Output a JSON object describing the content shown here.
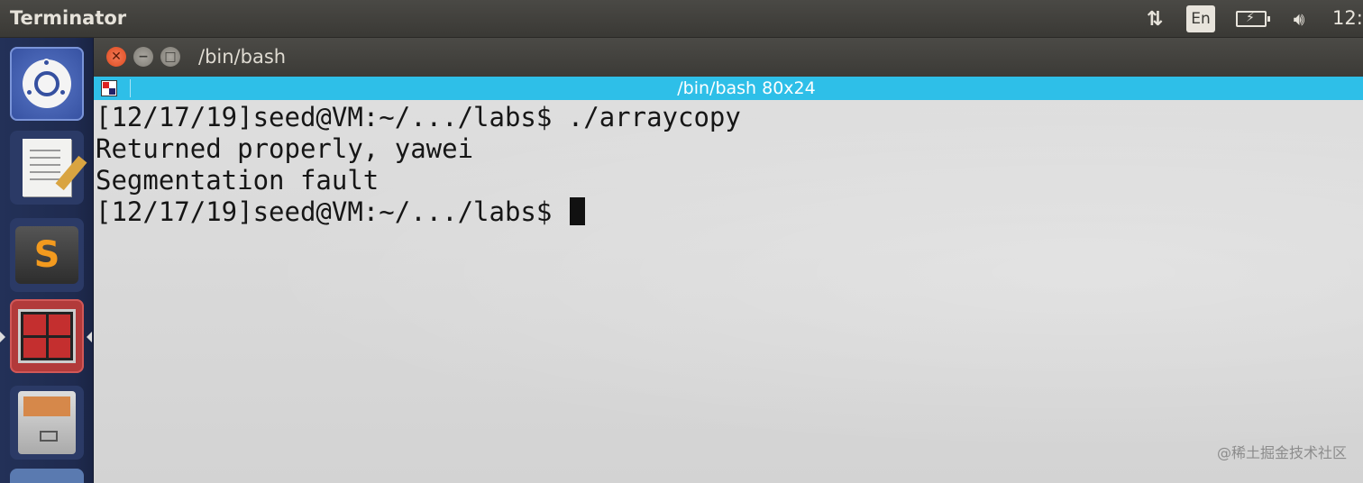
{
  "top_panel": {
    "app_name": "Terminator",
    "indicators": {
      "network_icon": "network-arrows-icon",
      "keyboard_layout": "En",
      "battery_icon": "battery-charging-icon",
      "volume_icon": "volume-icon"
    },
    "clock": "12:"
  },
  "launcher": {
    "items": [
      {
        "name": "ubuntu-dash",
        "icon": "ubuntu-logo-icon"
      },
      {
        "name": "text-editor",
        "icon": "text-editor-icon"
      },
      {
        "name": "sublime-text",
        "icon": "sublime-text-icon",
        "glyph": "S"
      },
      {
        "name": "terminator",
        "icon": "terminator-icon",
        "active": true
      },
      {
        "name": "files",
        "icon": "file-cabinet-icon"
      }
    ]
  },
  "window": {
    "title": "/bin/bash",
    "tab_title": "/bin/bash 80x24",
    "colors": {
      "titlebar": "#3c3b37",
      "tabbar": "#2ebfe8",
      "terminal_bg": "#d8d8d8",
      "terminal_fg": "#161616",
      "close_button": "#df4a1f"
    }
  },
  "terminal": {
    "lines": [
      "[12/17/19]seed@VM:~/.../labs$ ./arraycopy",
      "Returned properly, yawei",
      "Segmentation fault",
      "[12/17/19]seed@VM:~/.../labs$ "
    ]
  },
  "watermark": "@稀土掘金技术社区"
}
